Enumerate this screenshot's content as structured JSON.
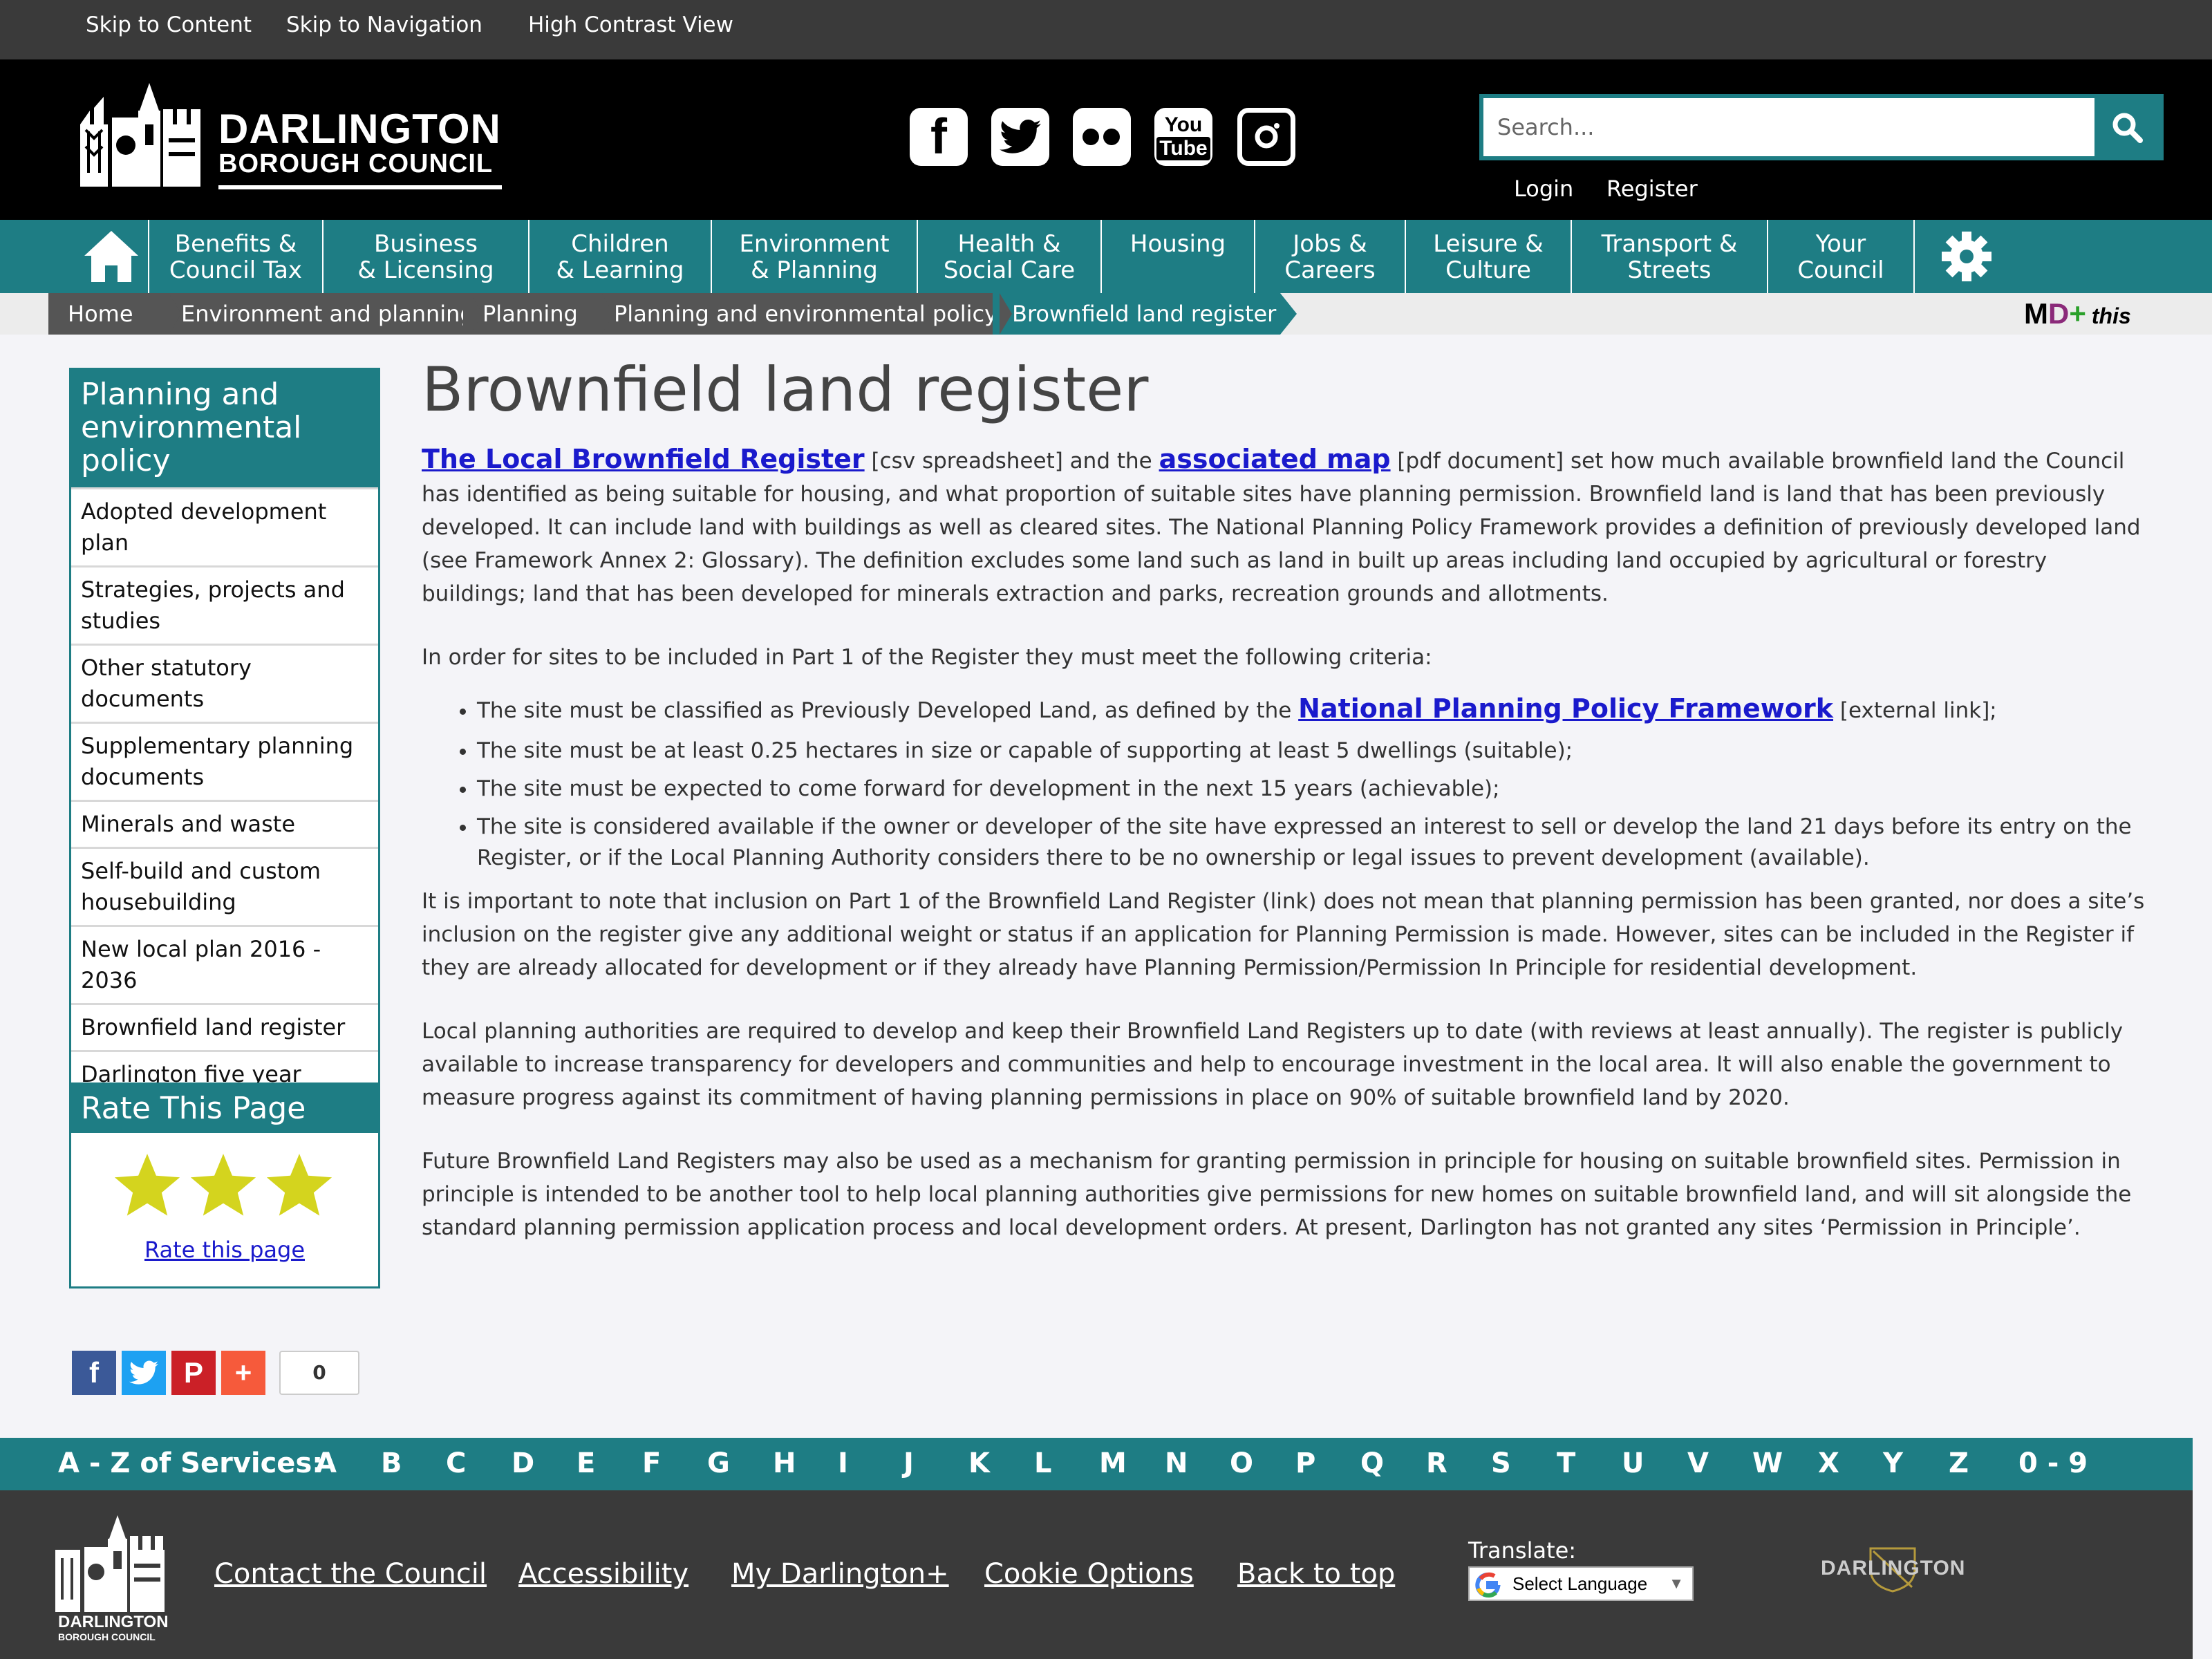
{
  "utility": {
    "skip_content": "Skip to Content",
    "skip_nav": "Skip to Navigation",
    "high_contrast": "High Contrast View"
  },
  "header": {
    "logo_line1": "DARLINGTON",
    "logo_line2": "BOROUGH COUNCIL",
    "social": [
      "facebook-icon",
      "twitter-icon",
      "flickr-icon",
      "youtube-icon",
      "instagram-icon"
    ],
    "youtube_you": "You",
    "youtube_tube": "Tube",
    "search_placeholder": "Search...",
    "login": "Login",
    "register": "Register"
  },
  "nav": {
    "items": [
      {
        "l1": "Benefits &",
        "l2": "Council Tax"
      },
      {
        "l1": "Business",
        "l2": "& Licensing"
      },
      {
        "l1": "Children",
        "l2": "& Learning"
      },
      {
        "l1": "Environment",
        "l2": "& Planning"
      },
      {
        "l1": "Health &",
        "l2": "Social Care"
      },
      {
        "l1": "Housing",
        "l2": ""
      },
      {
        "l1": "Jobs &",
        "l2": "Careers"
      },
      {
        "l1": "Leisure &",
        "l2": "Culture"
      },
      {
        "l1": "Transport &",
        "l2": "Streets"
      },
      {
        "l1": "Your",
        "l2": "Council"
      }
    ]
  },
  "breadcrumb": [
    "Home",
    "Environment and planning",
    "Planning",
    "Planning and environmental policy",
    "Brownfield land register"
  ],
  "md": {
    "m": "M",
    "d": "D",
    "plus": "+",
    "this": "this"
  },
  "sidebar": {
    "title": "Planning and environmental policy",
    "items": [
      "Adopted development plan",
      "Strategies, projects and studies",
      "Other statutory documents",
      "Supplementary planning documents",
      "Minerals and waste",
      "Self-build and custom housebuilding",
      "New local plan 2016 - 2036",
      "Brownfield land register",
      "Darlington five year housing land supply position statement"
    ]
  },
  "rate": {
    "title": "Rate This Page",
    "link": "Rate this page",
    "stars": 3
  },
  "content": {
    "title": "Brownfield land register",
    "p1_link1": "The Local Brownfield Register",
    "p1_text1": " [csv spreadsheet] and the ",
    "p1_link2": "associated map",
    "p1_text2": " [pdf document] set how much available brownfield land the Council has identified as being suitable for housing, and what proportion of suitable sites have planning permission. Brownfield land is land that has been previously developed. It can include land with buildings as well as cleared sites. The National Planning Policy Framework provides a definition of previously developed land (see Framework Annex 2: Glossary). The definition excludes some land such as land in built up areas including land occupied by agricultural or forestry buildings; land that has been developed for minerals extraction and parks, recreation grounds and allotments.",
    "p2": "In order for sites to be included in Part 1 of the Register they must meet the following criteria:",
    "li1_text": "The site must be classified as Previously Developed Land, as defined by the ",
    "li1_link": "National Planning Policy Framework",
    "li1_tail": " [external link];",
    "li2": "The site must be at least 0.25 hectares in size or capable of supporting at least 5 dwellings (suitable);",
    "li3": "The site must be expected to come forward for development in the next 15 years (achievable);",
    "li4": "The site is considered available if the owner or developer of the site have expressed an interest to sell or develop the land 21 days before its entry on the Register, or if the Local Planning Authority considers there to be no ownership or legal issues to prevent development (available).",
    "p3": "It is important to note that inclusion on Part 1 of the Brownfield Land Register (link) does not mean that planning permission has been granted, nor does a site’s inclusion on the register give any additional weight or status if an application for Planning Permission is made. However, sites can be included in the Register if they are already allocated for development or if they already have Planning Permission/Permission In Principle for residential development.",
    "p4": "Local planning authorities are required to develop and keep their Brownfield Land Registers up to date (with reviews at least annually). The register is publicly available to increase transparency for developers and communities and help to encourage investment in the local area. It will also enable the government to measure progress against its commitment of having planning permissions in place on 90% of suitable brownfield land by 2020.",
    "p5": "Future Brownfield Land Registers may also be used as a mechanism for granting permission in principle for housing on suitable brownfield sites. Permission in principle is intended to be another tool to help local planning authorities give permissions for new homes on suitable brownfield land, and will sit alongside the standard planning permission application process and local development orders. At present, Darlington has not granted any sites ‘Permission in Principle’."
  },
  "share": {
    "facebook": "f",
    "pinterest": "P",
    "more": "+",
    "count": "0",
    "colors": {
      "facebook": "#3b5998",
      "twitter": "#1da1f2",
      "pinterest": "#cb2027",
      "more": "#f65a3b"
    }
  },
  "az": {
    "label": "A - Z of Services:",
    "letters": [
      "A",
      "B",
      "C",
      "D",
      "E",
      "F",
      "G",
      "H",
      "I",
      "J",
      "K",
      "L",
      "M",
      "N",
      "O",
      "P",
      "Q",
      "R",
      "S",
      "T",
      "U",
      "V",
      "W",
      "X",
      "Y",
      "Z",
      "0 - 9"
    ]
  },
  "footer": {
    "logo_line1": "DARLINGTON",
    "logo_line2": "BOROUGH COUNCIL",
    "links": [
      "Contact the Council",
      "Accessibility",
      "My Darlington+",
      "Cookie Options",
      "Back to top"
    ],
    "translate_label": "Translate:",
    "translate_select": "Select Language",
    "translate_arrow": "▼",
    "brand": "DARLINGTON"
  },
  "colors": {
    "teal": "#1e7d84",
    "dark_bar": "#3a3a3a",
    "header_bg": "#000000",
    "link": "#1a1acc",
    "star": "#d4d41e"
  }
}
